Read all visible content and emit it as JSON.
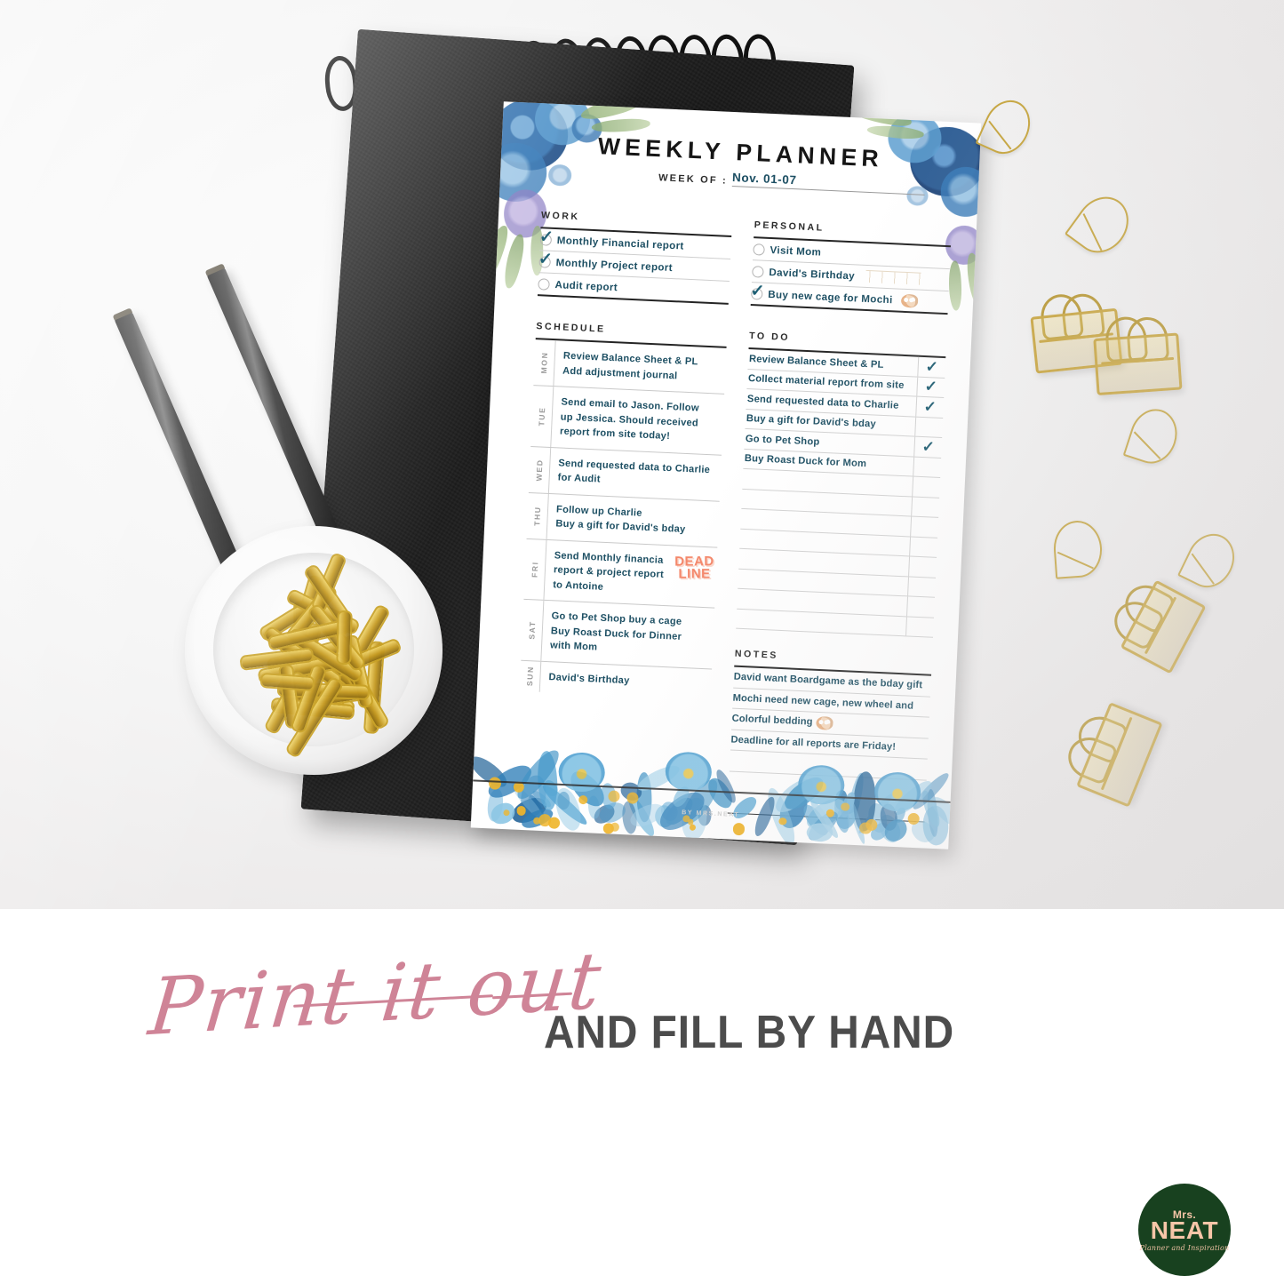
{
  "photo": {
    "alt_objects": [
      "two black pencils",
      "black spiral notebook",
      "white ceramic dish with gold paper clips",
      "gold wire teardrop clips",
      "gold binder clips"
    ]
  },
  "planner": {
    "title": "WEEKLY PLANNER",
    "week_of_label": "WEEK OF :",
    "week_of_value": "Nov. 01-07",
    "watermark": "BY MRS.NEAT",
    "work": {
      "heading": "WORK",
      "items": [
        {
          "label": "Monthly Financial report",
          "checked": true
        },
        {
          "label": "Monthly Project report",
          "checked": true
        },
        {
          "label": "Audit report",
          "checked": false
        }
      ]
    },
    "personal": {
      "heading": "PERSONAL",
      "items": [
        {
          "label": "Visit Mom",
          "checked": false,
          "sticker": ""
        },
        {
          "label": "David's Birthday",
          "checked": false,
          "sticker": "bunting"
        },
        {
          "label": "Buy new cage for Mochi",
          "checked": true,
          "sticker": "guinea-pig"
        }
      ]
    },
    "schedule": {
      "heading": "SCHEDULE",
      "days": [
        {
          "day": "MON",
          "lines": [
            "Review Balance Sheet & PL",
            "Add adjustment journal"
          ],
          "sticker": ""
        },
        {
          "day": "TUE",
          "lines": [
            "Send email to Jason. Follow",
            "up Jessica. Should received",
            "report from site today!"
          ],
          "sticker": ""
        },
        {
          "day": "WED",
          "lines": [
            "Send requested data to Charlie",
            "for Audit"
          ],
          "sticker": ""
        },
        {
          "day": "THU",
          "lines": [
            "Follow up Charlie",
            "Buy a gift for David's bday"
          ],
          "sticker": ""
        },
        {
          "day": "FRI",
          "lines": [
            "Send Monthly financia",
            "report & project report",
            "to Antoine"
          ],
          "sticker": "DEAD\nLINE"
        },
        {
          "day": "SAT",
          "lines": [
            "Go to Pet Shop buy a cage",
            "Buy Roast Duck for Dinner",
            "with Mom"
          ],
          "sticker": ""
        },
        {
          "day": "SUN",
          "lines": [
            "David's Birthday"
          ],
          "sticker": ""
        }
      ]
    },
    "todo": {
      "heading": "TO DO",
      "items": [
        {
          "label": "Review Balance Sheet & PL",
          "checked": true
        },
        {
          "label": "Collect material report from site",
          "checked": true
        },
        {
          "label": "Send requested data to Charlie",
          "checked": true
        },
        {
          "label": "Buy a gift for David's bday",
          "checked": false
        },
        {
          "label": "Go to Pet Shop",
          "checked": true
        },
        {
          "label": "Buy Roast Duck for Mom",
          "checked": false
        },
        {
          "label": "",
          "checked": false
        },
        {
          "label": "",
          "checked": false
        },
        {
          "label": "",
          "checked": false
        },
        {
          "label": "",
          "checked": false
        },
        {
          "label": "",
          "checked": false
        },
        {
          "label": "",
          "checked": false
        },
        {
          "label": "",
          "checked": false
        },
        {
          "label": "",
          "checked": false
        }
      ]
    },
    "notes": {
      "heading": "NOTES",
      "lines": [
        {
          "text": "David want Boardgame as the bday gift",
          "sticker": ""
        },
        {
          "text": "Mochi need new cage, new wheel and",
          "sticker": ""
        },
        {
          "text": "Colorful bedding",
          "sticker": "guinea-pig"
        },
        {
          "text": "Deadline for all reports are Friday!",
          "sticker": ""
        },
        {
          "text": "",
          "sticker": ""
        },
        {
          "text": "",
          "sticker": ""
        },
        {
          "text": "",
          "sticker": ""
        }
      ]
    },
    "check_glyph": "✓"
  },
  "banner": {
    "script_text": "Print it out",
    "caption_text": "AND FILL BY HAND"
  },
  "logo": {
    "prefix": "Mrs.",
    "name": "NEAT",
    "tagline": "Planner and Inspiration"
  },
  "colors": {
    "ink_blue": "#1d4f63",
    "check_teal": "#1b5b70",
    "deadline_orange": "#f4876a",
    "script_pink": "#cf8497",
    "caption_gray": "#4c4c4c",
    "logo_green": "#18411f",
    "logo_peach": "#f7c6a8",
    "gold": "#c6a53e"
  }
}
